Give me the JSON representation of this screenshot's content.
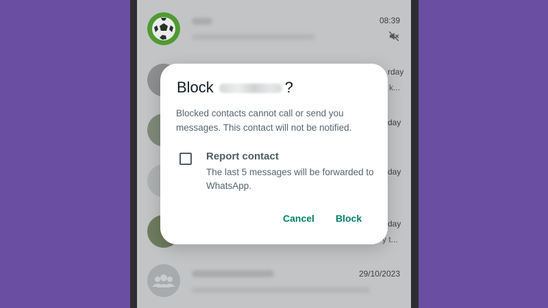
{
  "chat_list": {
    "rows": [
      {
        "time": "08:39",
        "muted": true,
        "avatar": "soccer-ball-icon"
      },
      {
        "time": "rday",
        "preview_tail": "k..."
      },
      {
        "time": "day",
        "preview_tail": ""
      },
      {
        "time": "day",
        "preview_tail": ""
      },
      {
        "time": "day",
        "preview_tail": "y t..."
      },
      {
        "time": "29/10/2023",
        "avatar": "group-icon"
      }
    ]
  },
  "dialog": {
    "title_prefix": "Block",
    "title_suffix": "?",
    "message": "Blocked contacts cannot call or send you messages. This contact will not be notified.",
    "report_label": "Report contact",
    "report_sub": "The last 5 messages will be forwarded to WhatsApp.",
    "cancel_label": "Cancel",
    "block_label": "Block"
  },
  "colors": {
    "background": "#6a4ea1",
    "accent": "#008069",
    "scrim": "#c2c4c5"
  }
}
